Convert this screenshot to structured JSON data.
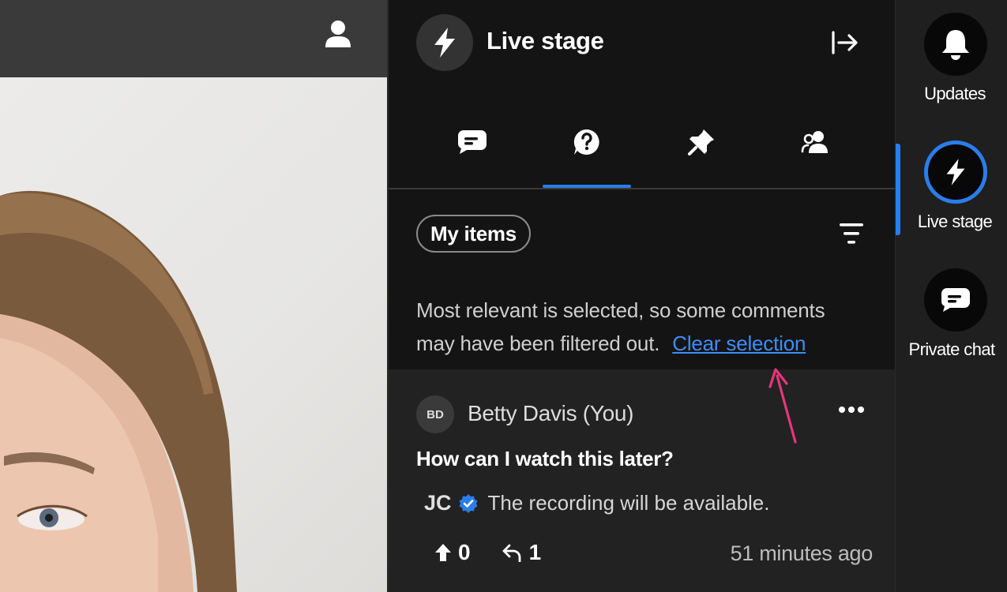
{
  "header": {
    "title": "Live stage"
  },
  "tabs": [
    {
      "name": "Chat",
      "icon": "chat-bubble-icon"
    },
    {
      "name": "Q&A",
      "icon": "question-bubble-icon",
      "active": true
    },
    {
      "name": "Pinned",
      "icon": "pin-icon"
    },
    {
      "name": "People",
      "icon": "people-icon"
    }
  ],
  "filter": {
    "chip_label": "My items",
    "notice_text": "Most relevant is selected, so some comments may have been filtered out.",
    "clear_link": "Clear selection"
  },
  "question_card": {
    "author_initials": "BD",
    "author_name": "Betty Davis (You)",
    "question": "How can I watch this later?",
    "reply": {
      "initials": "JC",
      "text": "The recording will be available."
    },
    "upvotes": "0",
    "replies": "1",
    "time": "51 minutes ago"
  },
  "rail": {
    "items": [
      {
        "label": "Updates",
        "icon": "bell-icon"
      },
      {
        "label": "Live stage",
        "icon": "lightning-icon",
        "active": true
      },
      {
        "label": "Private chat",
        "icon": "chat-bubble-icon"
      }
    ]
  },
  "colors": {
    "accent": "#2b7de9",
    "link": "#3e8ef7",
    "annotation": "#e8357a"
  }
}
